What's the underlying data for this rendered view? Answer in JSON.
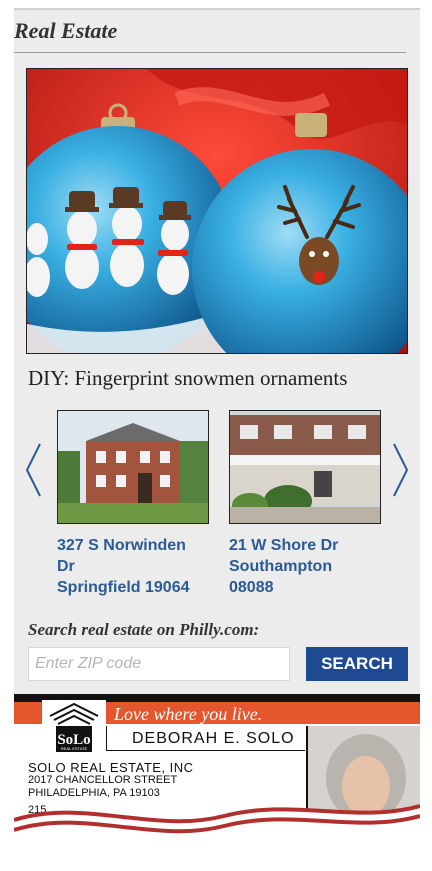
{
  "section": {
    "title": "Real Estate"
  },
  "hero": {
    "caption": "DIY: Fingerprint snowmen ornaments"
  },
  "carousel": {
    "listings": [
      {
        "address_line1": "327 S Norwinden",
        "address_line2": "Dr",
        "address_line3": "Springfield 19064"
      },
      {
        "address_line1": "21 W Shore Dr",
        "address_line2": "Southampton",
        "address_line3": "08088"
      }
    ],
    "prev_icon": "chevron-left-icon",
    "next_icon": "chevron-right-icon"
  },
  "search": {
    "label": "Search real estate on Philly.com:",
    "placeholder": "Enter ZIP code",
    "button_label": "SEARCH"
  },
  "ad": {
    "tagline": "Love where you live.",
    "logo_text": "SoLo",
    "logo_subtext": "REAL ESTATE",
    "agent_name": "DEBORAH E. SOLO",
    "company": "SOLO REAL ESTATE, INC",
    "street": "2017 CHANCELLOR STREET",
    "city": "PHILADELPHIA, PA 19103",
    "phone_partial": "215"
  },
  "colors": {
    "link_blue": "#2b5b95",
    "button_blue": "#1f4a91",
    "ad_red": "#e4572e",
    "ornament_blue": "#2a9bd6",
    "background_red": "#d8251c"
  }
}
